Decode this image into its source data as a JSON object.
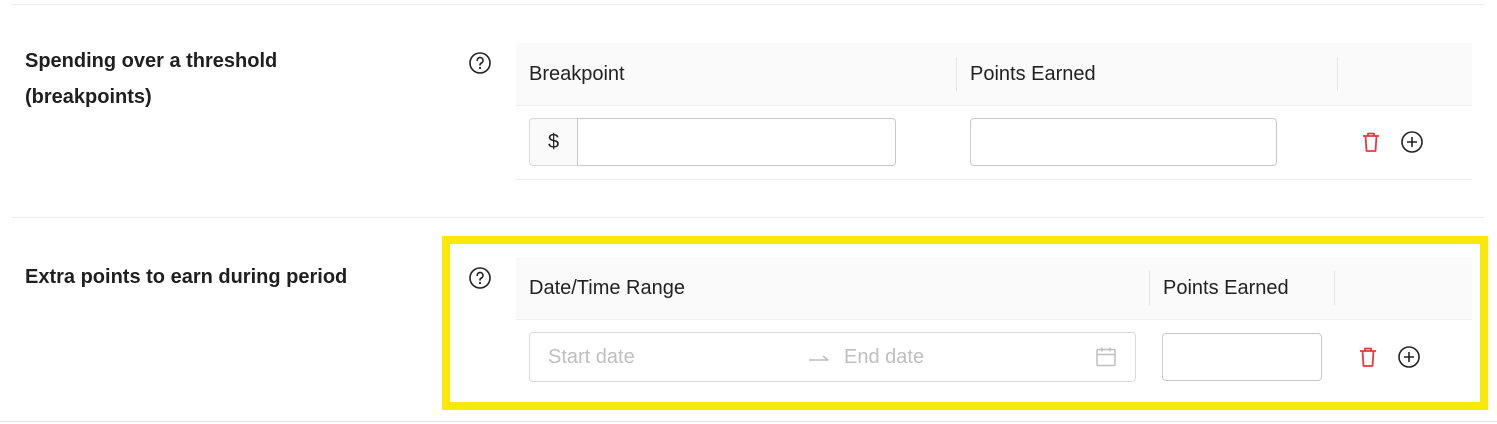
{
  "breakpoints": {
    "label_line1": "Spending over a threshold",
    "label_line2": "(breakpoints)",
    "help_icon": "question-circle-icon",
    "columns": [
      "Breakpoint",
      "Points Earned",
      ""
    ],
    "row": {
      "currency_prefix": "$",
      "breakpoint_value": "",
      "points_value": "",
      "delete_icon": "trash-icon",
      "add_icon": "plus-circle-icon"
    }
  },
  "period": {
    "label": "Extra points to earn during period",
    "help_icon": "question-circle-icon",
    "columns": [
      "Date/Time Range",
      "Points Earned",
      ""
    ],
    "row": {
      "start_placeholder": "Start date",
      "end_placeholder": "End date",
      "separator_icon": "arrow-right-icon",
      "calendar_icon": "calendar-icon",
      "points_value": "",
      "delete_icon": "trash-icon",
      "add_icon": "plus-circle-icon"
    }
  },
  "colors": {
    "highlight": "#fbe70a",
    "delete": "#e5393b",
    "header_bg": "#fafafa"
  }
}
